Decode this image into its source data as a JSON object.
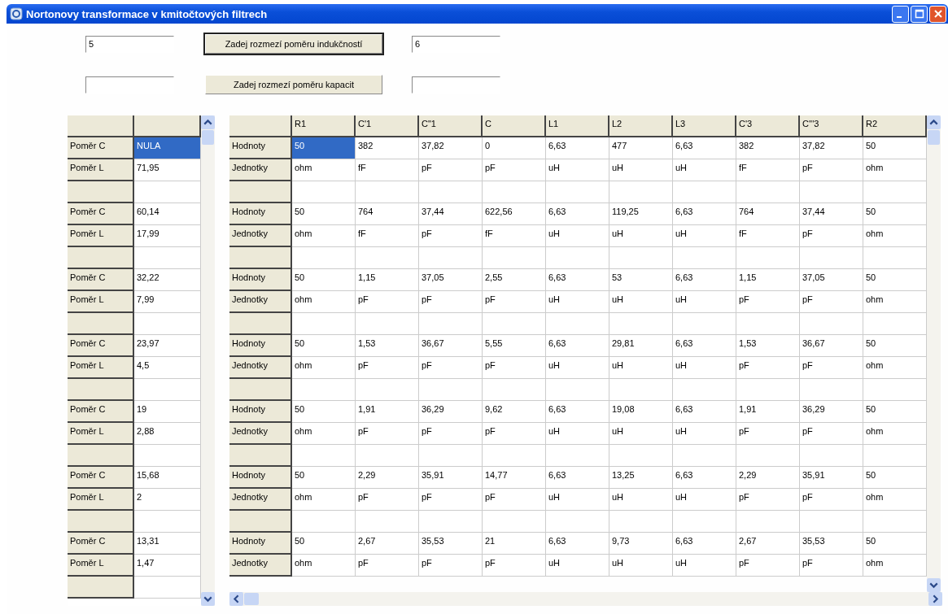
{
  "window": {
    "title": "Nortonovy transformace v kmitočtových filtrech"
  },
  "inductance": {
    "from": "5",
    "button": "Zadej rozmezí poměru indukčností",
    "to": "6",
    "focused": true
  },
  "capacitance": {
    "button": "Zadej rozmezí poměru kapacit",
    "focused": false
  },
  "ratio_grid": {
    "rows": [
      {
        "kind": "data",
        "label": "Poměr C",
        "value": "NULA",
        "selected": true
      },
      {
        "kind": "data",
        "label": "Poměr L",
        "value": "71,95",
        "selected": false
      },
      {
        "kind": "blank"
      },
      {
        "kind": "data",
        "label": "Poměr C",
        "value": "60,14",
        "selected": false
      },
      {
        "kind": "data",
        "label": "Poměr L",
        "value": "17,99",
        "selected": false
      },
      {
        "kind": "blank"
      },
      {
        "kind": "data",
        "label": "Poměr C",
        "value": "32,22",
        "selected": false
      },
      {
        "kind": "data",
        "label": "Poměr L",
        "value": "7,99",
        "selected": false
      },
      {
        "kind": "blank"
      },
      {
        "kind": "data",
        "label": "Poměr C",
        "value": "23,97",
        "selected": false
      },
      {
        "kind": "data",
        "label": "Poměr L",
        "value": "4,5",
        "selected": false
      },
      {
        "kind": "blank"
      },
      {
        "kind": "data",
        "label": "Poměr C",
        "value": "19",
        "selected": false
      },
      {
        "kind": "data",
        "label": "Poměr L",
        "value": "2,88",
        "selected": false
      },
      {
        "kind": "blank"
      },
      {
        "kind": "data",
        "label": "Poměr C",
        "value": "15,68",
        "selected": false
      },
      {
        "kind": "data",
        "label": "Poměr L",
        "value": "2",
        "selected": false
      },
      {
        "kind": "blank"
      },
      {
        "kind": "data",
        "label": "Poměr C",
        "value": "13,31",
        "selected": false
      },
      {
        "kind": "data",
        "label": "Poměr L",
        "value": "1,47",
        "selected": false
      },
      {
        "kind": "blank"
      }
    ]
  },
  "component_grid": {
    "columns": [
      "R1",
      "C'1",
      "C\"1",
      "C",
      "L1",
      "L2",
      "L3",
      "C'3",
      "C'''3",
      "R2"
    ],
    "rows": [
      {
        "kind": "data",
        "label": "Hodnoty",
        "cells": [
          {
            "text": "50",
            "selected": true
          },
          {
            "text": "382",
            "selected": false
          },
          {
            "text": "37,82",
            "selected": false
          },
          {
            "text": "0",
            "selected": false
          },
          {
            "text": "6,63",
            "selected": false
          },
          {
            "text": "477",
            "selected": false
          },
          {
            "text": "6,63",
            "selected": false
          },
          {
            "text": "382",
            "selected": false
          },
          {
            "text": "37,82",
            "selected": false
          },
          {
            "text": "50",
            "selected": false
          }
        ]
      },
      {
        "kind": "data",
        "label": "Jednotky",
        "cells": [
          {
            "text": "ohm",
            "selected": false
          },
          {
            "text": "fF",
            "selected": false
          },
          {
            "text": "pF",
            "selected": false
          },
          {
            "text": "pF",
            "selected": false
          },
          {
            "text": "uH",
            "selected": false
          },
          {
            "text": "uH",
            "selected": false
          },
          {
            "text": "uH",
            "selected": false
          },
          {
            "text": "fF",
            "selected": false
          },
          {
            "text": "pF",
            "selected": false
          },
          {
            "text": "ohm",
            "selected": false
          }
        ]
      },
      {
        "kind": "blank"
      },
      {
        "kind": "data",
        "label": "Hodnoty",
        "cells": [
          {
            "text": "50",
            "selected": false
          },
          {
            "text": "764",
            "selected": false
          },
          {
            "text": "37,44",
            "selected": false
          },
          {
            "text": "622,56",
            "selected": false
          },
          {
            "text": "6,63",
            "selected": false
          },
          {
            "text": "119,25",
            "selected": false
          },
          {
            "text": "6,63",
            "selected": false
          },
          {
            "text": "764",
            "selected": false
          },
          {
            "text": "37,44",
            "selected": false
          },
          {
            "text": "50",
            "selected": false
          }
        ]
      },
      {
        "kind": "data",
        "label": "Jednotky",
        "cells": [
          {
            "text": "ohm",
            "selected": false
          },
          {
            "text": "fF",
            "selected": false
          },
          {
            "text": "pF",
            "selected": false
          },
          {
            "text": "fF",
            "selected": false
          },
          {
            "text": "uH",
            "selected": false
          },
          {
            "text": "uH",
            "selected": false
          },
          {
            "text": "uH",
            "selected": false
          },
          {
            "text": "fF",
            "selected": false
          },
          {
            "text": "pF",
            "selected": false
          },
          {
            "text": "ohm",
            "selected": false
          }
        ]
      },
      {
        "kind": "blank"
      },
      {
        "kind": "data",
        "label": "Hodnoty",
        "cells": [
          {
            "text": "50",
            "selected": false
          },
          {
            "text": "1,15",
            "selected": false
          },
          {
            "text": "37,05",
            "selected": false
          },
          {
            "text": "2,55",
            "selected": false
          },
          {
            "text": "6,63",
            "selected": false
          },
          {
            "text": "53",
            "selected": false
          },
          {
            "text": "6,63",
            "selected": false
          },
          {
            "text": "1,15",
            "selected": false
          },
          {
            "text": "37,05",
            "selected": false
          },
          {
            "text": "50",
            "selected": false
          }
        ]
      },
      {
        "kind": "data",
        "label": "Jednotky",
        "cells": [
          {
            "text": "ohm",
            "selected": false
          },
          {
            "text": "pF",
            "selected": false
          },
          {
            "text": "pF",
            "selected": false
          },
          {
            "text": "pF",
            "selected": false
          },
          {
            "text": "uH",
            "selected": false
          },
          {
            "text": "uH",
            "selected": false
          },
          {
            "text": "uH",
            "selected": false
          },
          {
            "text": "pF",
            "selected": false
          },
          {
            "text": "pF",
            "selected": false
          },
          {
            "text": "ohm",
            "selected": false
          }
        ]
      },
      {
        "kind": "blank"
      },
      {
        "kind": "data",
        "label": "Hodnoty",
        "cells": [
          {
            "text": "50",
            "selected": false
          },
          {
            "text": "1,53",
            "selected": false
          },
          {
            "text": "36,67",
            "selected": false
          },
          {
            "text": "5,55",
            "selected": false
          },
          {
            "text": "6,63",
            "selected": false
          },
          {
            "text": "29,81",
            "selected": false
          },
          {
            "text": "6,63",
            "selected": false
          },
          {
            "text": "1,53",
            "selected": false
          },
          {
            "text": "36,67",
            "selected": false
          },
          {
            "text": "50",
            "selected": false
          }
        ]
      },
      {
        "kind": "data",
        "label": "Jednotky",
        "cells": [
          {
            "text": "ohm",
            "selected": false
          },
          {
            "text": "pF",
            "selected": false
          },
          {
            "text": "pF",
            "selected": false
          },
          {
            "text": "pF",
            "selected": false
          },
          {
            "text": "uH",
            "selected": false
          },
          {
            "text": "uH",
            "selected": false
          },
          {
            "text": "uH",
            "selected": false
          },
          {
            "text": "pF",
            "selected": false
          },
          {
            "text": "pF",
            "selected": false
          },
          {
            "text": "ohm",
            "selected": false
          }
        ]
      },
      {
        "kind": "blank"
      },
      {
        "kind": "data",
        "label": "Hodnoty",
        "cells": [
          {
            "text": "50",
            "selected": false
          },
          {
            "text": "1,91",
            "selected": false
          },
          {
            "text": "36,29",
            "selected": false
          },
          {
            "text": "9,62",
            "selected": false
          },
          {
            "text": "6,63",
            "selected": false
          },
          {
            "text": "19,08",
            "selected": false
          },
          {
            "text": "6,63",
            "selected": false
          },
          {
            "text": "1,91",
            "selected": false
          },
          {
            "text": "36,29",
            "selected": false
          },
          {
            "text": "50",
            "selected": false
          }
        ]
      },
      {
        "kind": "data",
        "label": "Jednotky",
        "cells": [
          {
            "text": "ohm",
            "selected": false
          },
          {
            "text": "pF",
            "selected": false
          },
          {
            "text": "pF",
            "selected": false
          },
          {
            "text": "pF",
            "selected": false
          },
          {
            "text": "uH",
            "selected": false
          },
          {
            "text": "uH",
            "selected": false
          },
          {
            "text": "uH",
            "selected": false
          },
          {
            "text": "pF",
            "selected": false
          },
          {
            "text": "pF",
            "selected": false
          },
          {
            "text": "ohm",
            "selected": false
          }
        ]
      },
      {
        "kind": "blank"
      },
      {
        "kind": "data",
        "label": "Hodnoty",
        "cells": [
          {
            "text": "50",
            "selected": false
          },
          {
            "text": "2,29",
            "selected": false
          },
          {
            "text": "35,91",
            "selected": false
          },
          {
            "text": "14,77",
            "selected": false
          },
          {
            "text": "6,63",
            "selected": false
          },
          {
            "text": "13,25",
            "selected": false
          },
          {
            "text": "6,63",
            "selected": false
          },
          {
            "text": "2,29",
            "selected": false
          },
          {
            "text": "35,91",
            "selected": false
          },
          {
            "text": "50",
            "selected": false
          }
        ]
      },
      {
        "kind": "data",
        "label": "Jednotky",
        "cells": [
          {
            "text": "ohm",
            "selected": false
          },
          {
            "text": "pF",
            "selected": false
          },
          {
            "text": "pF",
            "selected": false
          },
          {
            "text": "pF",
            "selected": false
          },
          {
            "text": "uH",
            "selected": false
          },
          {
            "text": "uH",
            "selected": false
          },
          {
            "text": "uH",
            "selected": false
          },
          {
            "text": "pF",
            "selected": false
          },
          {
            "text": "pF",
            "selected": false
          },
          {
            "text": "ohm",
            "selected": false
          }
        ]
      },
      {
        "kind": "blank"
      },
      {
        "kind": "data",
        "label": "Hodnoty",
        "cells": [
          {
            "text": "50",
            "selected": false
          },
          {
            "text": "2,67",
            "selected": false
          },
          {
            "text": "35,53",
            "selected": false
          },
          {
            "text": "21",
            "selected": false
          },
          {
            "text": "6,63",
            "selected": false
          },
          {
            "text": "9,73",
            "selected": false
          },
          {
            "text": "6,63",
            "selected": false
          },
          {
            "text": "2,67",
            "selected": false
          },
          {
            "text": "35,53",
            "selected": false
          },
          {
            "text": "50",
            "selected": false
          }
        ]
      },
      {
        "kind": "data",
        "label": "Jednotky",
        "cells": [
          {
            "text": "ohm",
            "selected": false
          },
          {
            "text": "pF",
            "selected": false
          },
          {
            "text": "pF",
            "selected": false
          },
          {
            "text": "pF",
            "selected": false
          },
          {
            "text": "uH",
            "selected": false
          },
          {
            "text": "uH",
            "selected": false
          },
          {
            "text": "uH",
            "selected": false
          },
          {
            "text": "pF",
            "selected": false
          },
          {
            "text": "pF",
            "selected": false
          },
          {
            "text": "ohm",
            "selected": false
          }
        ]
      }
    ]
  }
}
